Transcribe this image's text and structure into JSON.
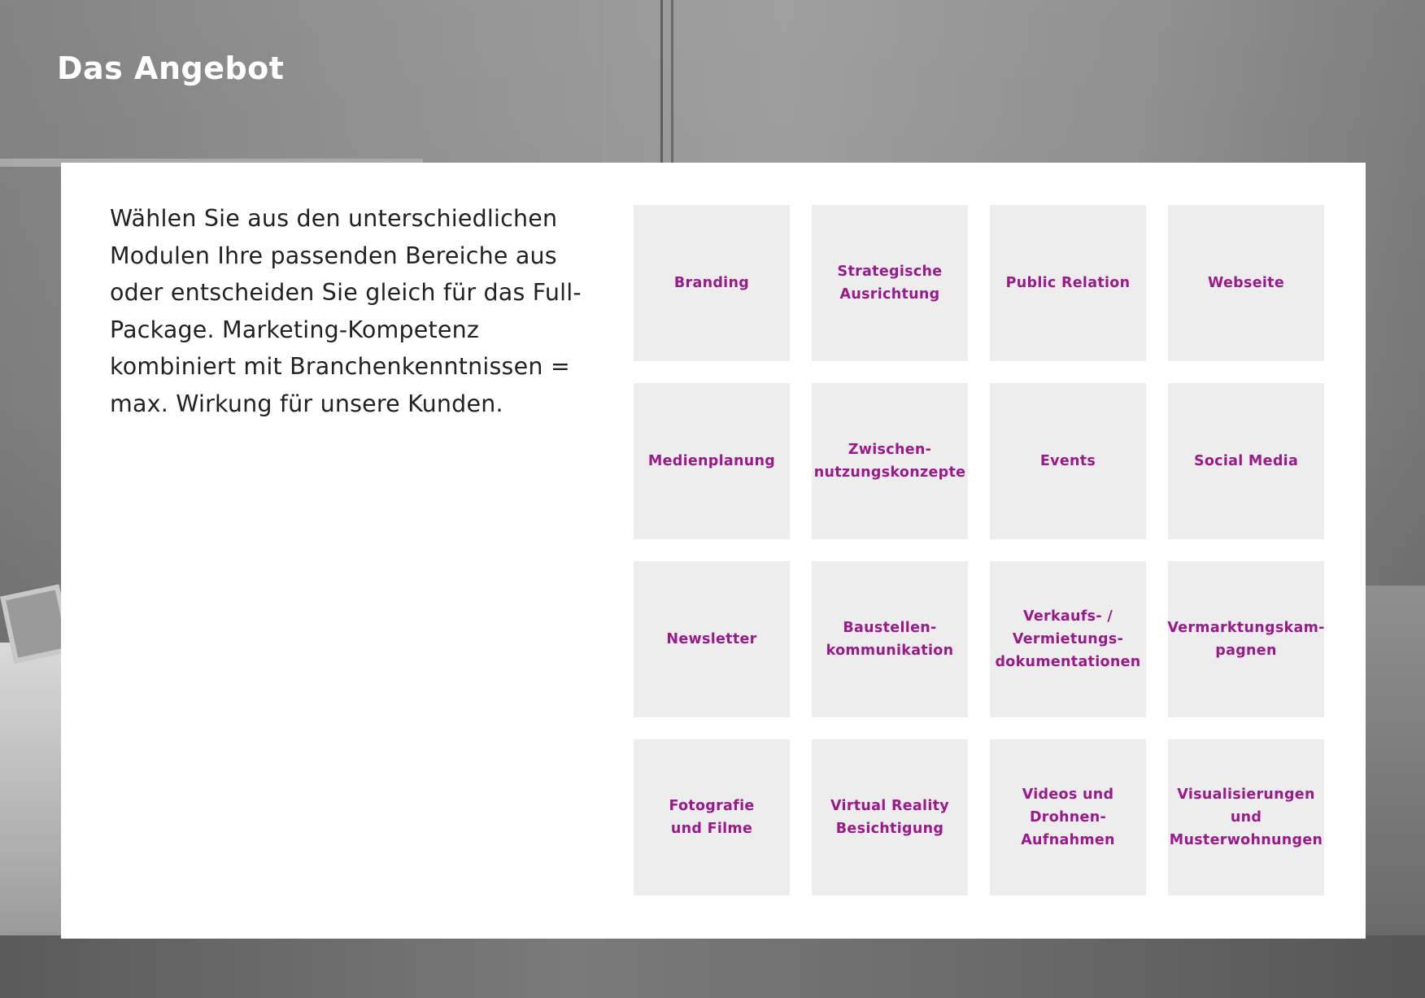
{
  "page": {
    "title": "Das Angebot"
  },
  "intro": {
    "text": "Wählen Sie aus den unterschiedlichen Modulen Ihre passenden Bereiche aus oder entscheiden Sie gleich für das Full-Package. Marketing-Kompetenz kombiniert mit Branchenkenntnissen = max. Wirkung für unsere Kunden."
  },
  "modules": [
    {
      "label": "Branding"
    },
    {
      "label": "Strategische\nAusrichtung"
    },
    {
      "label": "Public Relation"
    },
    {
      "label": "Webseite"
    },
    {
      "label": "Medienplanung"
    },
    {
      "label": "Zwischen-\nnutzungskonzepte"
    },
    {
      "label": "Events"
    },
    {
      "label": "Social Media"
    },
    {
      "label": "Newsletter"
    },
    {
      "label": "Baustellen-\nkommunikation"
    },
    {
      "label": "Verkaufs- /\nVermietungs-\ndokumentationen"
    },
    {
      "label": "Vermarktungskam-\npagnen"
    },
    {
      "label": "Fotografie\nund Filme"
    },
    {
      "label": "Virtual Reality\nBesichtigung"
    },
    {
      "label": "Videos und\nDrohnen-\nAufnahmen"
    },
    {
      "label": "Visualisierungen\nund\nMusterwohnungen"
    }
  ],
  "colors": {
    "accent": "#9a1a8c",
    "tile_background": "#ededed",
    "panel_background": "#ffffff",
    "title_text": "#ffffff",
    "body_text": "#222222"
  }
}
